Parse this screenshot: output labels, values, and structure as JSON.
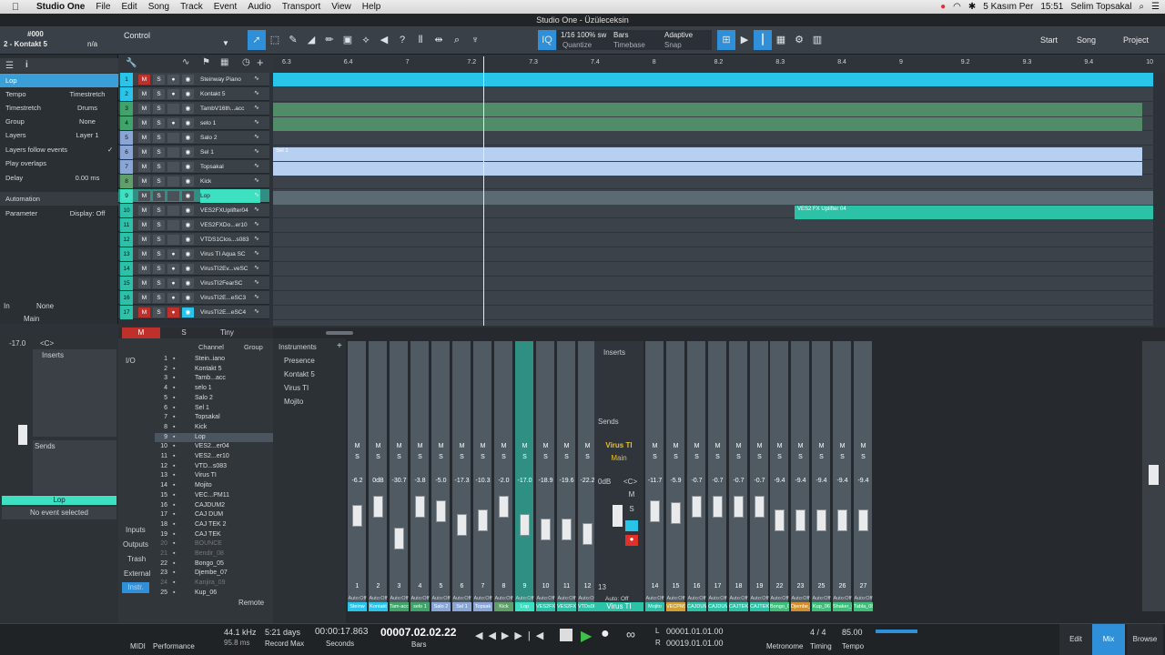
{
  "menubar": {
    "app": "Studio One",
    "items": [
      "File",
      "Edit",
      "Song",
      "Track",
      "Event",
      "Audio",
      "Transport",
      "View",
      "Help"
    ],
    "date": "5 Kasım Per",
    "time": "15:51",
    "user": "Selim Topsakal"
  },
  "window": {
    "title": "Studio One - Üzüleceksin"
  },
  "toolbar": {
    "track_id": "#000",
    "track_name": "2 - Kontakt 5",
    "control": "Control",
    "na": "n/a",
    "quantize_value": "1/16 100% sw",
    "quantize": "Quantize",
    "timebase_value": "Bars",
    "timebase": "Timebase",
    "snap_value": "Adaptive",
    "snap": "Snap",
    "start": "Start",
    "song": "Song",
    "project": "Project"
  },
  "inspector": {
    "track": "Lop",
    "tempo": "Tempo",
    "tempo_val": "Timestretch",
    "timestretch": "Timestretch",
    "timestretch_val": "Drums",
    "group": "Group",
    "group_val": "None",
    "layers": "Layers",
    "layers_val": "Layer 1",
    "follow": "Layers follow events",
    "overlaps": "Play overlaps",
    "delay": "Delay",
    "delay_val": "0.00 ms",
    "automation": "Automation",
    "parameter": "Parameter",
    "display": "Display: Off",
    "in": "In",
    "in_val": "None",
    "main": "Main",
    "vol": "-17.0",
    "pan": "<C>",
    "inserts": "Inserts",
    "sends": "Sends",
    "channel_name": "Lop",
    "no_event": "No event selected"
  },
  "ruler": [
    "6.3",
    "6.4",
    "7",
    "7.2",
    "7.3",
    "7.4",
    "8",
    "8.2",
    "8.3",
    "8.4",
    "9",
    "9.2",
    "9.3",
    "9.4",
    "10"
  ],
  "tracks": [
    {
      "n": "1",
      "name": "Steinway Piano",
      "color": "#29c4ea",
      "rec": true
    },
    {
      "n": "2",
      "name": "Kontakt 5",
      "color": "#29c4ea",
      "rec": true
    },
    {
      "n": "3",
      "name": "TambV16th...acc",
      "color": "#3fa36a",
      "rec": false
    },
    {
      "n": "4",
      "name": "selo 1",
      "color": "#3fa36a",
      "rec": true
    },
    {
      "n": "5",
      "name": "Salo 2",
      "color": "#8aa6d6",
      "rec": false
    },
    {
      "n": "6",
      "name": "Sel 1",
      "color": "#8aa6d6",
      "rec": false
    },
    {
      "n": "7",
      "name": "Topsakal",
      "color": "#8aa6d6",
      "rec": false
    },
    {
      "n": "8",
      "name": "Kick",
      "color": "#5fa06a",
      "rec": false
    },
    {
      "n": "9",
      "name": "Lop",
      "color": "#3de0c0",
      "rec": false
    },
    {
      "n": "10",
      "name": "VES2FXUplifter04",
      "color": "#2bc2a8",
      "rec": false
    },
    {
      "n": "11",
      "name": "VES2FXDo...er10",
      "color": "#2bc2a8",
      "rec": false
    },
    {
      "n": "12",
      "name": "VTDS1Clos...s083",
      "color": "#2bc2a8",
      "rec": false
    },
    {
      "n": "13",
      "name": "Virus TI Aqua SC",
      "color": "#2bc2a8",
      "rec": true
    },
    {
      "n": "14",
      "name": "VirusTI2Ev...veSC",
      "color": "#2bc2a8",
      "rec": true
    },
    {
      "n": "15",
      "name": "VirusTI2FearSC",
      "color": "#2bc2a8",
      "rec": true
    },
    {
      "n": "16",
      "name": "VirusTI2E...eSC3",
      "color": "#2bc2a8",
      "rec": true
    },
    {
      "n": "17",
      "name": "VirusTI2E...eSC4",
      "color": "#2bc2a8",
      "rec": true
    }
  ],
  "clips": {
    "uplifter": "VES2 FX Uplifter 04",
    "sel": "Sel 1"
  },
  "chanlist": {
    "header_m": "M",
    "header_s": "S",
    "tiny": "Tiny",
    "channel": "Channel",
    "group": "Group",
    "io": "I/O",
    "inputs": "Inputs",
    "outputs": "Outputs",
    "trash": "Trash",
    "external": "External",
    "instr": "Instr.",
    "remote": "Remote",
    "rows": [
      [
        "1",
        "Stein..iano"
      ],
      [
        "2",
        "Kontakt 5"
      ],
      [
        "3",
        "Tamb...acc"
      ],
      [
        "4",
        "selo 1"
      ],
      [
        "5",
        "Salo 2"
      ],
      [
        "6",
        "Sel 1"
      ],
      [
        "7",
        "Topsakal"
      ],
      [
        "8",
        "Kick"
      ],
      [
        "9",
        "Lop"
      ],
      [
        "10",
        "VES2...er04"
      ],
      [
        "11",
        "VES2...er10"
      ],
      [
        "12",
        "VTD...s083"
      ],
      [
        "13",
        "Virus TI"
      ],
      [
        "14",
        "Mojito"
      ],
      [
        "15",
        "VEC...PM11"
      ],
      [
        "16",
        "CAJDUM2"
      ],
      [
        "17",
        "CAJ DUM"
      ],
      [
        "18",
        "CAJ TEK 2"
      ],
      [
        "19",
        "CAJ TEK"
      ],
      [
        "20",
        "BOUNCE"
      ],
      [
        "21",
        "Bendir_08"
      ],
      [
        "22",
        "Bongo_05"
      ],
      [
        "23",
        "Djembe_07"
      ],
      [
        "24",
        "Kanjira_09"
      ],
      [
        "25",
        "Kup_06"
      ]
    ]
  },
  "instruments": {
    "title": "Instruments",
    "items": [
      "Presence",
      "Kontakt 5",
      "Virus TI",
      "Mojito"
    ]
  },
  "strips": [
    {
      "vol": "-6.2",
      "num": "1",
      "name": "Steinw",
      "color": "#29c4ea"
    },
    {
      "vol": "0dB",
      "num": "2",
      "name": "Kontakt",
      "color": "#29c4ea"
    },
    {
      "vol": "-30.7",
      "num": "3",
      "name": "Tam-acc",
      "color": "#3fa36a"
    },
    {
      "vol": "-3.8",
      "num": "4",
      "name": "selo 1",
      "color": "#3fa36a"
    },
    {
      "vol": "-5.0",
      "num": "5",
      "name": "Salo 2",
      "color": "#8aa6d6"
    },
    {
      "vol": "-17.3",
      "num": "6",
      "name": "Sel 1",
      "color": "#8aa6d6"
    },
    {
      "vol": "-10.3",
      "num": "7",
      "name": "Topsak",
      "color": "#8aa6d6"
    },
    {
      "vol": "-2.0",
      "num": "8",
      "name": "Kick",
      "color": "#5fa06a"
    },
    {
      "vol": "-17.0",
      "num": "9",
      "name": "Lop",
      "color": "#3de0c0"
    },
    {
      "vol": "-18.9",
      "num": "10",
      "name": "VES2FX",
      "color": "#2bc2a8"
    },
    {
      "vol": "-19.6",
      "num": "11",
      "name": "VES2FX",
      "color": "#2bc2a8"
    },
    {
      "vol": "-22.2",
      "num": "12",
      "name": "VTDs083",
      "color": "#2bc2a8"
    },
    {
      "vol": "-11.7",
      "num": "14",
      "name": "Mojito",
      "color": "#2bc2a8"
    },
    {
      "vol": "-5.9",
      "num": "15",
      "name": "VECPM11",
      "color": "#d0a030"
    },
    {
      "vol": "-0.7",
      "num": "16",
      "name": "CAJDUM2",
      "color": "#2bc2a8"
    },
    {
      "vol": "-0.7",
      "num": "17",
      "name": "CAJDUM",
      "color": "#2bc2a8"
    },
    {
      "vol": "-0.7",
      "num": "18",
      "name": "CAJTEK2",
      "color": "#2bc2a8"
    },
    {
      "vol": "-0.7",
      "num": "19",
      "name": "CAJTEK",
      "color": "#2bc2a8"
    },
    {
      "vol": "-9.4",
      "num": "22",
      "name": "Bongo_05",
      "color": "#3fc07a"
    },
    {
      "vol": "-9.4",
      "num": "23",
      "name": "Djembe_07",
      "color": "#d09030"
    },
    {
      "vol": "-9.4",
      "num": "25",
      "name": "Kup_06",
      "color": "#3fc07a"
    },
    {
      "vol": "-9.4",
      "num": "26",
      "name": "Shaker_06",
      "color": "#3fc07a"
    },
    {
      "vol": "-9.4",
      "num": "27",
      "name": "Tabla_08",
      "color": "#3fc07a"
    }
  ],
  "virus_strip": {
    "name": "Virus TI",
    "main": "Main",
    "vol": "0dB",
    "pan": "<C>",
    "num": "13",
    "auto": "Auto: Off"
  },
  "transport": {
    "midi": "MIDI",
    "performance": "Performance",
    "rate": "44.1 kHz",
    "rate_sub": "95.8 ms",
    "days": "5:21 days",
    "record_max": "Record Max",
    "time": "00:00:17.863",
    "seconds": "Seconds",
    "bars_val": "00007.02.02.22",
    "bars": "Bars",
    "loop_l": "00001.01.01.00",
    "loop_r": "00019.01.01.00",
    "metronome": "Metronome",
    "timing_val": "4 / 4",
    "timing": "Timing",
    "tempo_val": "85.00",
    "tempo": "Tempo",
    "edit": "Edit",
    "mix": "Mix",
    "browse": "Browse"
  }
}
